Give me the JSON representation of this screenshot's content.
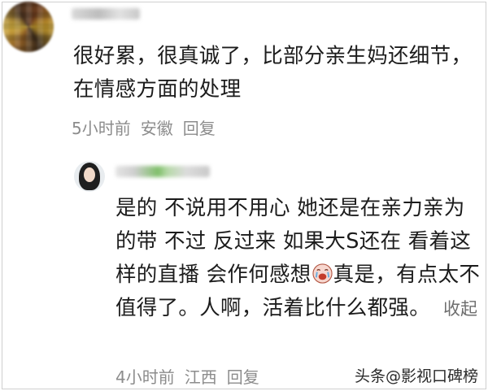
{
  "top_comment": {
    "text": "很好累，很真诚了，比部分亲生妈还细节，在情感方面的处理",
    "meta": {
      "time": "5小时前",
      "location": "安徽",
      "reply_label": "回复"
    }
  },
  "reply_comment": {
    "text_before_emoji": "是的 不说用不用心 她还是在亲力亲为的带 不过 反过来 如果大S还在 看着这样的直播 会作何感想",
    "emoji": "crying-face",
    "text_after_emoji": "真是，有点太不值得了。人啊，活着比什么都强。",
    "collapse_label": "收起",
    "meta": {
      "time": "4小时前",
      "location": "江西",
      "reply_label": "回复"
    }
  },
  "watermark": "头条@影视口碑榜",
  "colors": {
    "text": "#1c1c1c",
    "meta": "#8c8c8c",
    "link": "#6e6e6e"
  }
}
